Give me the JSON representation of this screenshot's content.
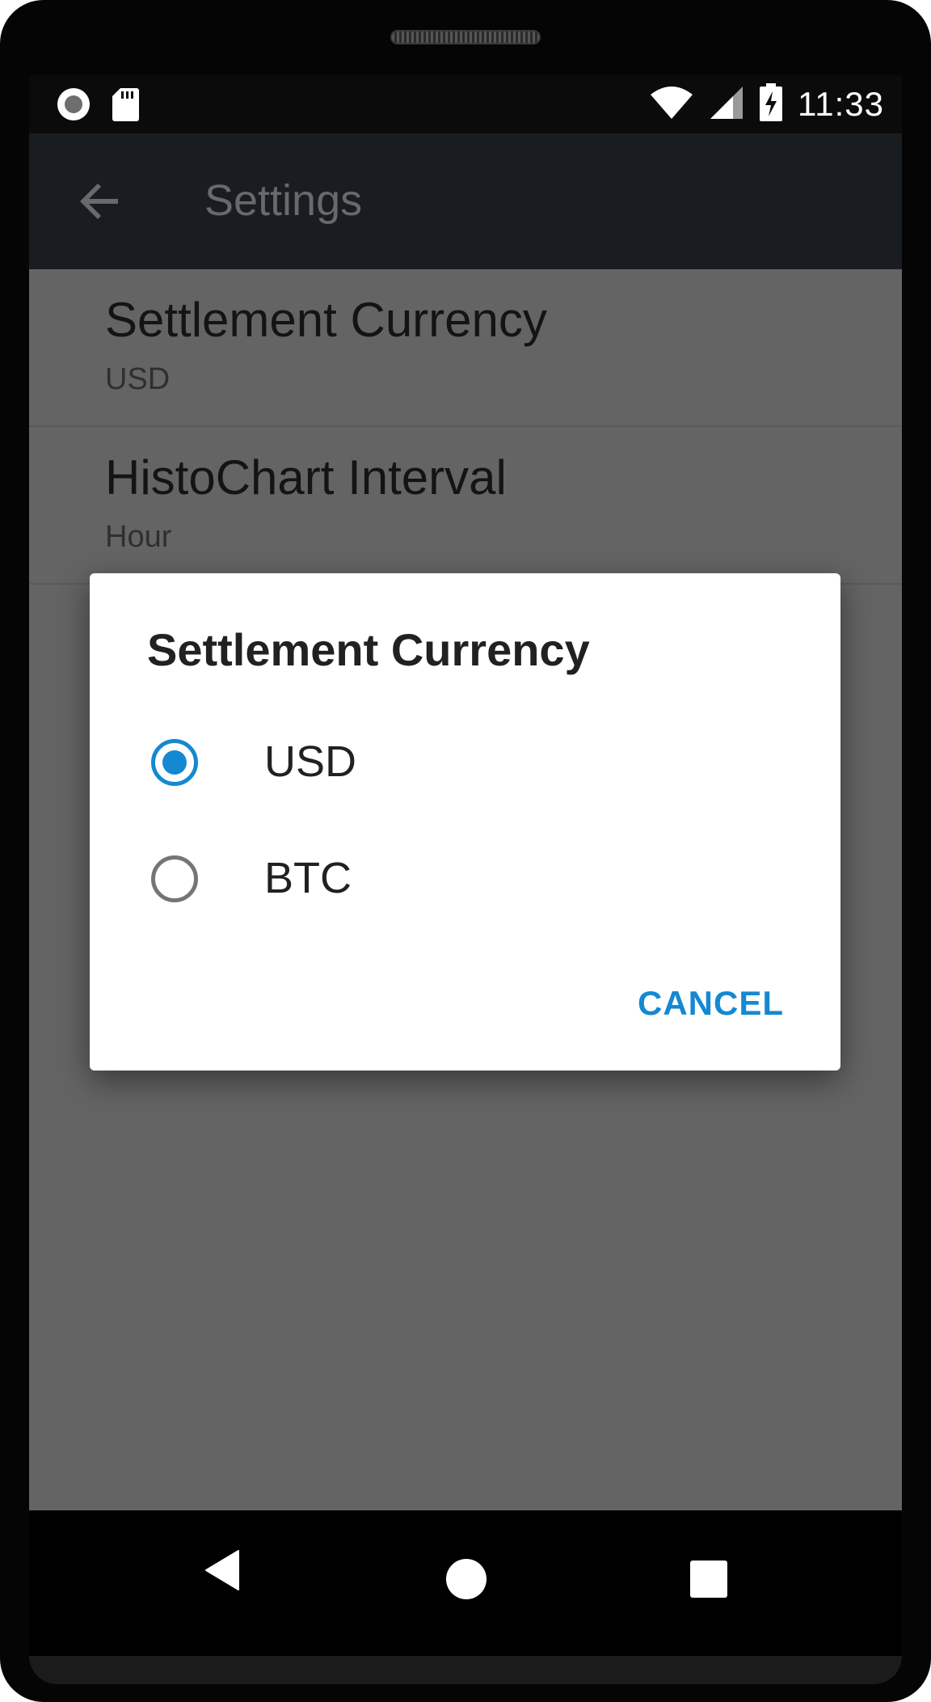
{
  "status_bar": {
    "time": "11:33",
    "icons": [
      "record-icon",
      "sd-card-icon",
      "wifi-icon",
      "cell-signal-icon",
      "battery-charging-icon"
    ]
  },
  "app_bar": {
    "title": "Settings",
    "back_icon": "arrow-back-icon"
  },
  "preferences": [
    {
      "title": "Settlement Currency",
      "summary": "USD"
    },
    {
      "title": "HistoChart Interval",
      "summary": "Hour"
    }
  ],
  "dialog": {
    "title": "Settlement Currency",
    "options": [
      {
        "label": "USD",
        "selected": true
      },
      {
        "label": "BTC",
        "selected": false
      }
    ],
    "cancel_label": "CANCEL"
  },
  "nav_bar": {
    "icons": [
      "nav-back-icon",
      "nav-home-icon",
      "nav-recents-icon"
    ]
  },
  "colors": {
    "accent": "#1489d1",
    "app_bar": "#191d21",
    "scrim_background": "#646464",
    "status_bar": "#0b0b0b"
  }
}
